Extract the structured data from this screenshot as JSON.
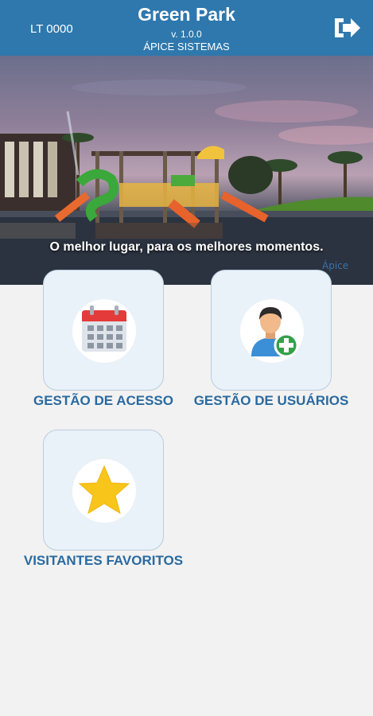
{
  "header": {
    "lot": "LT 0000",
    "title": "Green Park",
    "version": "v. 1.0.0",
    "company": "ÁPICE SISTEMAS",
    "logout_icon": "logout-icon"
  },
  "hero": {
    "tagline": "O melhor lugar, para os melhores momentos."
  },
  "menu": [
    {
      "label": "GESTÃO DE ACESSO",
      "icon": "calendar-icon"
    },
    {
      "label": "GESTÃO DE USUÁRIOS",
      "icon": "add-user-icon"
    },
    {
      "label": "VISITANTES FAVORITOS",
      "icon": "star-icon"
    }
  ],
  "colors": {
    "header_bg": "#2e78ad",
    "label": "#2a6aa0",
    "tile_bg": "#e9f1f9",
    "page_bg": "#f2f2f2"
  }
}
